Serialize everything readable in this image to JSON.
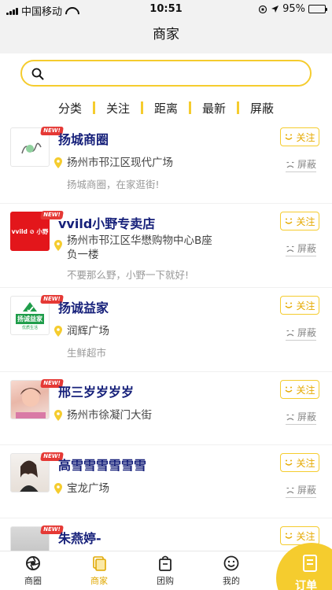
{
  "status": {
    "carrier": "中国移动",
    "time": "10:51",
    "battery": "95%",
    "battery_level": 0.95
  },
  "header": {
    "title": "商家"
  },
  "search": {
    "placeholder": ""
  },
  "tabs": [
    "分类",
    "关注",
    "距离",
    "最新",
    "屏蔽"
  ],
  "actions": {
    "follow": "关注",
    "block": "屏蔽"
  },
  "badge": "NEW!",
  "merchants": [
    {
      "name": "扬城商圈",
      "address": "扬州市邗江区现代广场",
      "desc": "扬城商圈，在家逛街!"
    },
    {
      "name": "vvild小野专卖店",
      "address": "扬州市邗江区华懋购物中心B座负一楼",
      "desc": "不要那么野，小野一下就好!"
    },
    {
      "name": "扬诚益家",
      "address": "润辉广场",
      "desc": "生鲜超市"
    },
    {
      "name": "邢三岁岁岁岁",
      "address": "扬州市徐凝门大街",
      "desc": ""
    },
    {
      "name": "高雪雪雪雪雪雪",
      "address": "宝龙广场",
      "desc": ""
    },
    {
      "name": "朱燕婷-",
      "address": "",
      "desc": ""
    }
  ],
  "thumb_text": {
    "vvild": "vvild ⊘ 小野",
    "yicheng": "扬诚益家",
    "yicheng_sub": "优质生活"
  },
  "nav": {
    "items": [
      "商圈",
      "商家",
      "团购",
      "我的"
    ],
    "order": "订单"
  },
  "colors": {
    "accent": "#f5cc2e",
    "name": "#16207a",
    "badge": "#e53935"
  }
}
